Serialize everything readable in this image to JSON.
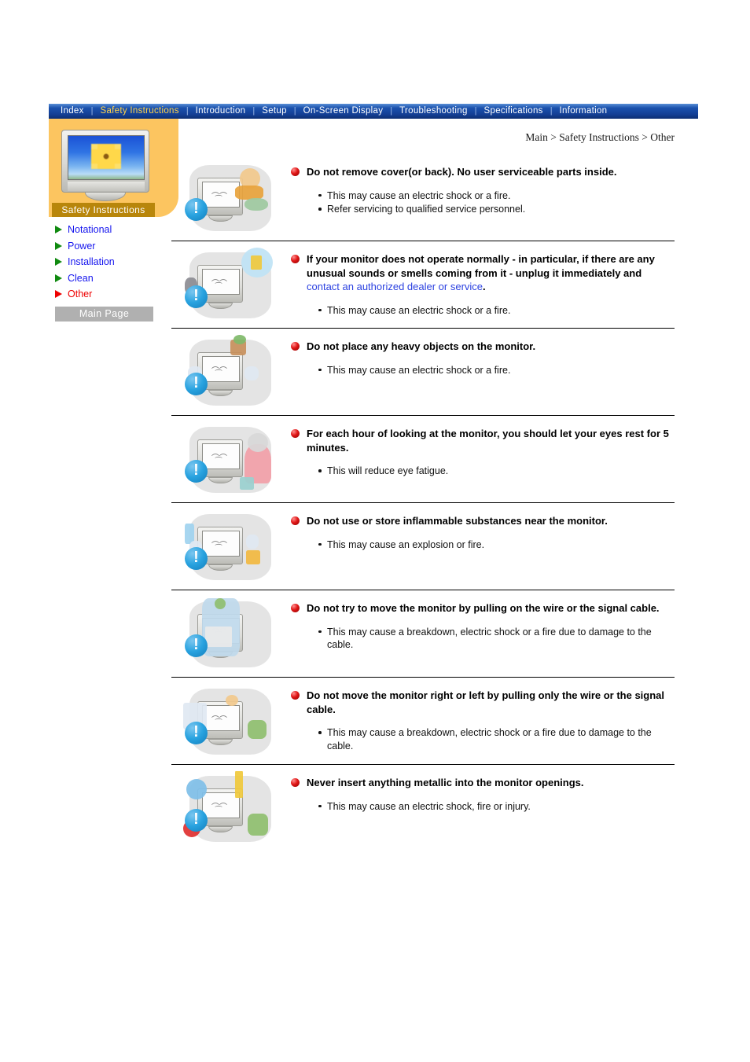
{
  "nav": {
    "items": [
      {
        "label": "Index",
        "active": false
      },
      {
        "label": "Safety Instructions",
        "active": true
      },
      {
        "label": "Introduction",
        "active": false
      },
      {
        "label": "Setup",
        "active": false
      },
      {
        "label": "On-Screen Display",
        "active": false
      },
      {
        "label": "Troubleshooting",
        "active": false
      },
      {
        "label": "Specifications",
        "active": false
      },
      {
        "label": "Information",
        "active": false
      }
    ]
  },
  "sidebar": {
    "title": "Safety Instructions",
    "links": [
      {
        "label": "Notational",
        "current": false
      },
      {
        "label": "Power",
        "current": false
      },
      {
        "label": "Installation",
        "current": false
      },
      {
        "label": "Clean",
        "current": false
      },
      {
        "label": "Other",
        "current": true
      }
    ],
    "main_page_button": "Main Page",
    "thumbnail_icon": "monitor-flower-thumbnail"
  },
  "breadcrumb": "Main > Safety Instructions > Other",
  "colors": {
    "nav_background": "#1b52ad",
    "nav_active_text": "#ffd24a",
    "sidebar_panel": "#fcc560",
    "sidebar_title_bar": "#b8860b",
    "link_blue": "#1515ee",
    "current_red": "#ee0000",
    "arrow_green": "#108a10",
    "main_page_button": "#b0b0b0",
    "warning_badge": "#29a3e0",
    "heading_bullet": "#e01616",
    "inline_link": "#2b41e0"
  },
  "sections": [
    {
      "illustration": "monitor-cover-removal-warning-illustration",
      "heading": "Do not remove cover(or back). No user serviceable parts inside.",
      "heading_link": null,
      "heading_tail": null,
      "notes": [
        "This may cause an electric shock or a fire.",
        "Refer servicing to qualified service personnel."
      ]
    },
    {
      "illustration": "monitor-abnormal-operation-unplug-illustration",
      "heading": "If your monitor does not operate normally - in particular, if there are any unusual sounds or smells coming from it - unplug it immediately and ",
      "heading_link": "contact an authorized dealer or service",
      "heading_tail": ".",
      "notes": [
        "This may cause an electric shock or a fire."
      ]
    },
    {
      "illustration": "monitor-heavy-objects-warning-illustration",
      "heading": "Do not place any heavy objects on the monitor.",
      "heading_link": null,
      "heading_tail": null,
      "notes": [
        "This may cause an electric shock or a fire."
      ]
    },
    {
      "illustration": "eye-rest-break-illustration",
      "heading": "For each hour of looking at the monitor, you should let your eyes rest for 5 minutes.",
      "heading_link": null,
      "heading_tail": null,
      "notes": [
        "This will reduce eye fatigue."
      ]
    },
    {
      "illustration": "inflammable-substances-warning-illustration",
      "heading": "Do not use or store inflammable substances near the monitor.",
      "heading_link": null,
      "heading_tail": null,
      "notes": [
        "This may cause an explosion or fire."
      ]
    },
    {
      "illustration": "do-not-pull-wire-illustration",
      "heading": "Do not try to move the monitor by pulling on the wire or the signal cable.",
      "heading_link": null,
      "heading_tail": null,
      "notes": [
        "This may cause a breakdown, electric shock or a fire due to damage to the cable."
      ]
    },
    {
      "illustration": "do-not-move-monitor-by-cable-illustration",
      "heading": "Do not move the monitor right or left by pulling only the wire or the signal cable.",
      "heading_link": null,
      "heading_tail": null,
      "notes": [
        "This may cause a breakdown, electric shock or a fire due to damage to the cable."
      ]
    },
    {
      "illustration": "no-metallic-objects-in-openings-illustration",
      "heading": "Never insert anything metallic into the monitor openings.",
      "heading_link": null,
      "heading_tail": null,
      "notes": [
        "This may cause an electric shock, fire or injury."
      ]
    }
  ]
}
